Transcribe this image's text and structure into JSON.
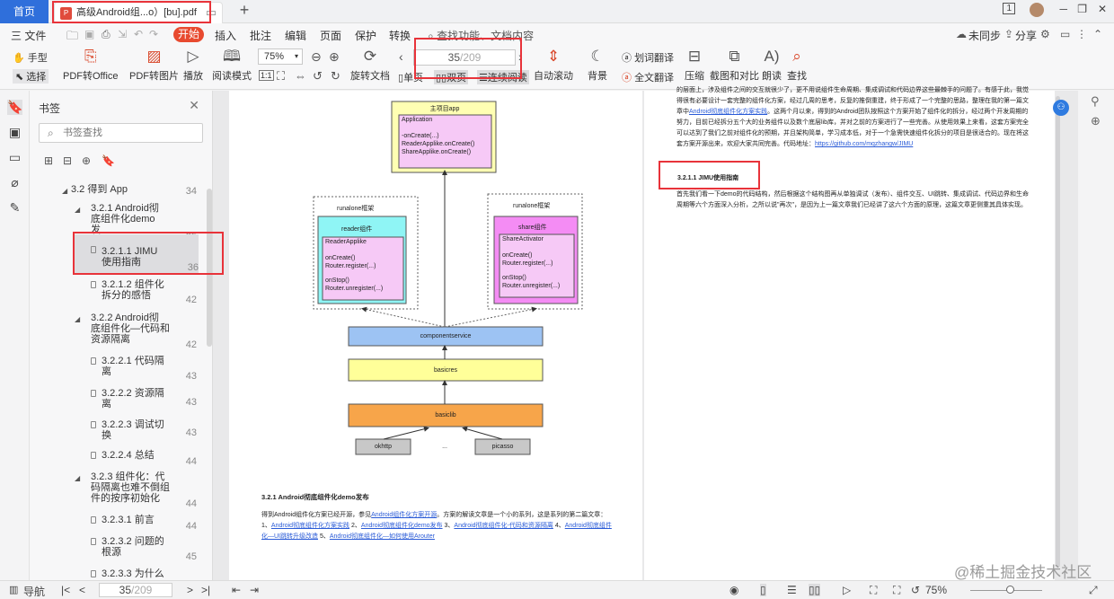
{
  "tabs": {
    "home_label": "首页",
    "doc_title": "高级Android组...o）[bu].pdf",
    "new_tab": "+"
  },
  "window": {
    "page_indicator": "1",
    "minimize": "─",
    "restore": "❐",
    "close": "✕"
  },
  "menu": {
    "file": "三 文件",
    "items": [
      "开始",
      "插入",
      "批注",
      "编辑",
      "页面",
      "保护",
      "转换"
    ],
    "search_func": "查找功能、文档内容",
    "sync": "未同步",
    "share": "分享"
  },
  "toolbar": {
    "hand": "手型",
    "select": "选择",
    "pdf_to_office": "PDF转Office",
    "pdf_to_image": "PDF转图片",
    "play": "播放",
    "reading_mode": "阅读模式",
    "zoom": "75%",
    "rotate": "旋转文档",
    "page_current": "35",
    "page_total": "/209",
    "single_page": "单页",
    "double_page": "双页",
    "continuous": "连续阅读",
    "auto_scroll": "自动滚动",
    "background": "背景",
    "word_translate": "划词翻译",
    "full_translate": "全文翻译",
    "compress": "压缩",
    "screenshot_compare": "截图和对比",
    "read_aloud": "朗读",
    "find": "查找"
  },
  "bookmarks": {
    "title": "书签",
    "search_placeholder": "书签查找",
    "items": [
      {
        "label": "3.2 得到 App",
        "page": "34"
      },
      {
        "label": "3.2.1 Android彻\n底组件化demo发\n布",
        "page": "35"
      },
      {
        "label": "3.2.1.1 JIMU\n使用指南",
        "page": "36"
      },
      {
        "label": "3.2.1.2 组件化\n拆分的感悟",
        "page": "42"
      },
      {
        "label": "3.2.2 Android彻\n底组件化—代码和\n资源隔离",
        "page": "42"
      },
      {
        "label": "3.2.2.1 代码隔\n离",
        "page": "43"
      },
      {
        "label": "3.2.2.2 资源隔\n离",
        "page": "43"
      },
      {
        "label": "3.2.2.3 调试切\n换",
        "page": "43"
      },
      {
        "label": "3.2.2.4 总结",
        "page": "44"
      },
      {
        "label": "3.2.3 组件化：代\n码隔离也难不倒组\n件的按序初始化",
        "page": "44"
      },
      {
        "label": "3.2.3.1 前言",
        "page": "44"
      },
      {
        "label": "3.2.3.2 问题的\n根源",
        "page": "45"
      },
      {
        "label": "3.2.3.3 为什么",
        "page": "45"
      }
    ]
  },
  "diagram": {
    "main_app": "主项目app",
    "application": "Application",
    "app_lines": [
      "-onCreate(...)",
      "ReaderApplike.onCreate()",
      "ShareApplike.onCreate()"
    ],
    "reader_frame": "runalone框架",
    "share_frame": "runalone框架",
    "reader_comp": "reader组件",
    "share_comp": "share组件",
    "reader_class": "ReaderApplike",
    "share_class": "ShareActivator",
    "reader_lines": [
      "onCreate()",
      "Router.register(...)",
      "",
      "onStop()",
      "Router.unregister(...)"
    ],
    "share_lines": [
      "onCreate()",
      "Router.register(...)",
      "",
      "onStop()",
      "Router.unregister(...)"
    ],
    "componentservice": "componentservice",
    "basicres": "basicres",
    "basiclib": "basiclib",
    "okhttp": "okhttp",
    "dots": "...",
    "picasso": "picasso"
  },
  "left_page": {
    "heading": "3.2.1 Android彻底组件化demo发布",
    "p1": "得到Android组件化方案已经开源，参见",
    "p1_link": "Android组件化方案开源",
    "p1_rest": "。方案的解读文章是一个小的系列，这是系列的第二篇文章：1、",
    "links": [
      "Android彻底组件化方案实践",
      "Android彻底组件化demo发布",
      "Android彻底组件化-代码和资源隔离",
      "Android彻底组件化—UI跳转升级改造",
      "Android彻底组件化—如何使用Arouter"
    ],
    "nums": [
      "2、",
      "3、",
      "4、",
      "5、"
    ]
  },
  "right_page": {
    "top_text": "的层面上，涉及组件之间的交互就很少了，更不用说组件生命周期、集成调试和代码边界这些最棘手的问题了。有感于此，我觉得很有必要设计一套完整的组件化方案，经过几周的思考，反复的推倒重建，终于形成了一个完整的思路，整理在我的第一篇文章中",
    "top_link": "Android彻底组件化方案实践",
    "top_text2": "。这两个月以来，得到的Android团队按照这个方案开始了组件化的拆分，经过两个开发周期的努力，目前已经拆分五个大的业务组件以及数个底层lib库，并对之前的方案进行了一些完善。从使用效果上来看，这套方案完全可以达到了我们之前对组件化的预期，并且架构简单，学习成本低，对于一个急需快速组件化拆分的项目是很适合的。现在将这套方案开源出来，欢迎大家共同完善。代码地址：",
    "code_link": "https://github.com/mqzhangw/JIMU",
    "section": "3.2.1.1 JIMU使用指南",
    "body": "首先我们看一下demo的代码结构，然后根据这个结构图再从单独调试（发布）、组件交互、UI跳转、集成调试、代码边界和生命周期等六个方面深入分析，之所以说\"再次\"，是因为上一篇文章我们已经讲了这六个方面的原理，这篇文章更侧重其具体实现。"
  },
  "status": {
    "nav": "导航",
    "page_current": "35",
    "page_total": "/209",
    "zoom": "75%",
    "watermark": "@稀土掘金技术社区"
  }
}
